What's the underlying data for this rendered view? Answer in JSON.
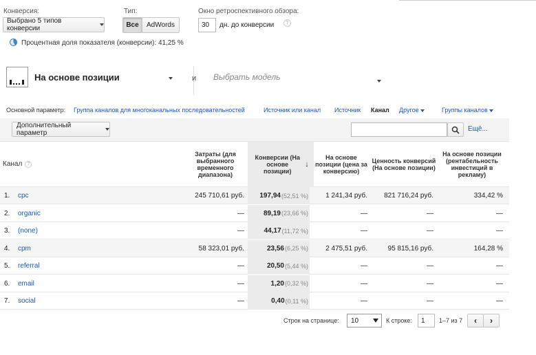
{
  "filters": {
    "conversion_label": "Конверсия:",
    "conversion_value": "Выбрано 5 типов конверсии",
    "type_label": "Тип:",
    "type_all": "Все",
    "type_adwords": "AdWords",
    "lookback_label": "Окно ретроспективного обзора:",
    "lookback_value": "30",
    "lookback_unit": "дн. до конверсии",
    "share_text": "Процентная доля показателя (конверсии): 41,25 %"
  },
  "model": {
    "primary": "На основе позиции",
    "and": "и",
    "secondary_placeholder": "Выбрать модель"
  },
  "dimensions": {
    "label": "Основной параметр:",
    "items": [
      "Группа каналов для многоканальных последовательностей",
      "Источник или канал",
      "Источник",
      "Канал",
      "Другое",
      "Группы каналов"
    ],
    "active": "Канал"
  },
  "toolbar": {
    "secondary_dimension": "Дополнительный параметр",
    "search_placeholder": "",
    "more": "Ещё..."
  },
  "table": {
    "col_channel": "Канал",
    "col_cost": "Затраты (для выбранного временного диапазона)",
    "col_conv": "Конверсии (На основе позиции)",
    "col_cpc": "На основе позиции (цена за конверсию)",
    "col_value": "Ценность конверсий (На основе позиции)",
    "col_roi": "На основе позиции (рентабельность инвестиций в рекламу)",
    "rows": [
      {
        "num": "1.",
        "name": "cpc",
        "cost": "245 710,61 руб.",
        "conv": "197,94",
        "pct": "(52,51 %)",
        "cpc": "1 241,34 руб.",
        "value": "821 716,24 руб.",
        "roi": "334,42 %"
      },
      {
        "num": "2.",
        "name": "organic",
        "cost": "—",
        "conv": "89,19",
        "pct": "(23,66 %)",
        "cpc": "—",
        "value": "—",
        "roi": "—"
      },
      {
        "num": "3.",
        "name": "(none)",
        "cost": "—",
        "conv": "44,17",
        "pct": "(11,72 %)",
        "cpc": "—",
        "value": "—",
        "roi": "—"
      },
      {
        "num": "4.",
        "name": "cpm",
        "cost": "58 323,01 руб.",
        "conv": "23,56",
        "pct": "(6,25 %)",
        "cpc": "2 475,51 руб.",
        "value": "95 815,16 руб.",
        "roi": "164,28 %"
      },
      {
        "num": "5.",
        "name": "referral",
        "cost": "—",
        "conv": "20,50",
        "pct": "(5,44 %)",
        "cpc": "—",
        "value": "—",
        "roi": "—"
      },
      {
        "num": "6.",
        "name": "email",
        "cost": "—",
        "conv": "1,20",
        "pct": "(0,32 %)",
        "cpc": "—",
        "value": "—",
        "roi": "—"
      },
      {
        "num": "7.",
        "name": "social",
        "cost": "—",
        "conv": "0,40",
        "pct": "(0,11 %)",
        "cpc": "—",
        "value": "—",
        "roi": "—"
      }
    ]
  },
  "pagination": {
    "rows_label": "Строк на странице:",
    "rows_value": "10",
    "goto_label": "К строке:",
    "goto_value": "1",
    "range": "1–7 из 7"
  }
}
